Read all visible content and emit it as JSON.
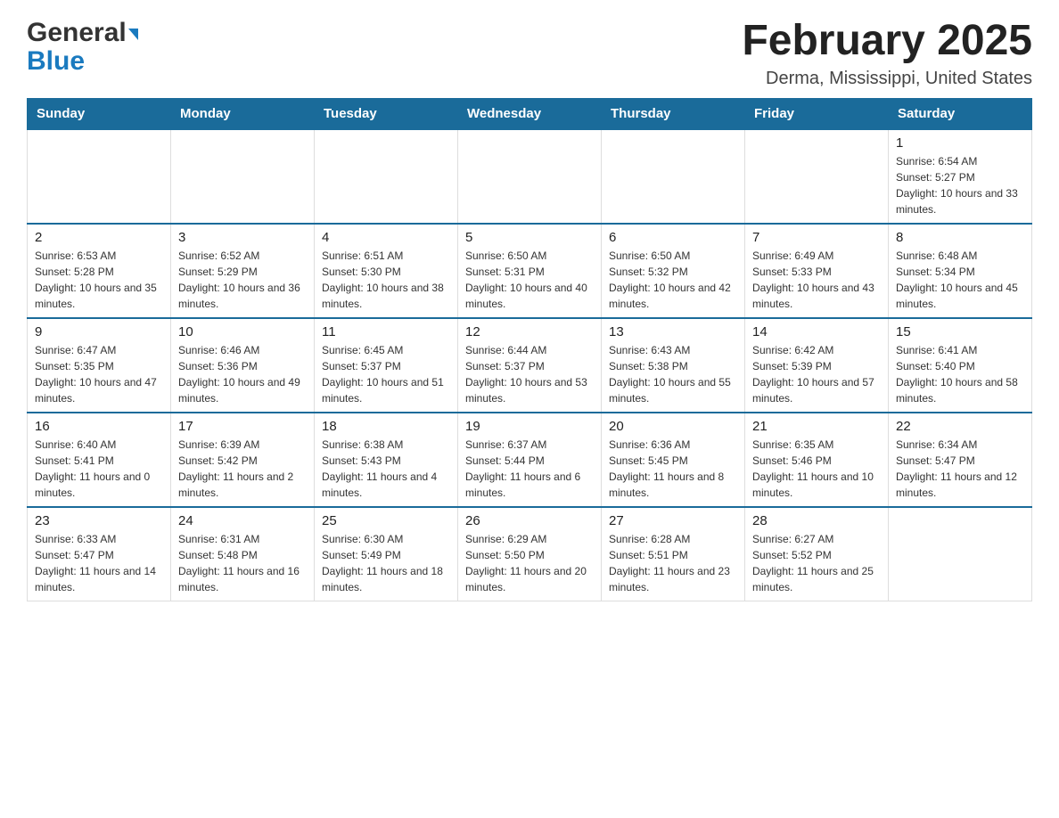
{
  "header": {
    "logo_general": "General",
    "logo_blue": "Blue",
    "month_title": "February 2025",
    "location": "Derma, Mississippi, United States"
  },
  "days_of_week": [
    "Sunday",
    "Monday",
    "Tuesday",
    "Wednesday",
    "Thursday",
    "Friday",
    "Saturday"
  ],
  "weeks": [
    [
      {
        "day": "",
        "info": ""
      },
      {
        "day": "",
        "info": ""
      },
      {
        "day": "",
        "info": ""
      },
      {
        "day": "",
        "info": ""
      },
      {
        "day": "",
        "info": ""
      },
      {
        "day": "",
        "info": ""
      },
      {
        "day": "1",
        "info": "Sunrise: 6:54 AM\nSunset: 5:27 PM\nDaylight: 10 hours and 33 minutes."
      }
    ],
    [
      {
        "day": "2",
        "info": "Sunrise: 6:53 AM\nSunset: 5:28 PM\nDaylight: 10 hours and 35 minutes."
      },
      {
        "day": "3",
        "info": "Sunrise: 6:52 AM\nSunset: 5:29 PM\nDaylight: 10 hours and 36 minutes."
      },
      {
        "day": "4",
        "info": "Sunrise: 6:51 AM\nSunset: 5:30 PM\nDaylight: 10 hours and 38 minutes."
      },
      {
        "day": "5",
        "info": "Sunrise: 6:50 AM\nSunset: 5:31 PM\nDaylight: 10 hours and 40 minutes."
      },
      {
        "day": "6",
        "info": "Sunrise: 6:50 AM\nSunset: 5:32 PM\nDaylight: 10 hours and 42 minutes."
      },
      {
        "day": "7",
        "info": "Sunrise: 6:49 AM\nSunset: 5:33 PM\nDaylight: 10 hours and 43 minutes."
      },
      {
        "day": "8",
        "info": "Sunrise: 6:48 AM\nSunset: 5:34 PM\nDaylight: 10 hours and 45 minutes."
      }
    ],
    [
      {
        "day": "9",
        "info": "Sunrise: 6:47 AM\nSunset: 5:35 PM\nDaylight: 10 hours and 47 minutes."
      },
      {
        "day": "10",
        "info": "Sunrise: 6:46 AM\nSunset: 5:36 PM\nDaylight: 10 hours and 49 minutes."
      },
      {
        "day": "11",
        "info": "Sunrise: 6:45 AM\nSunset: 5:37 PM\nDaylight: 10 hours and 51 minutes."
      },
      {
        "day": "12",
        "info": "Sunrise: 6:44 AM\nSunset: 5:37 PM\nDaylight: 10 hours and 53 minutes."
      },
      {
        "day": "13",
        "info": "Sunrise: 6:43 AM\nSunset: 5:38 PM\nDaylight: 10 hours and 55 minutes."
      },
      {
        "day": "14",
        "info": "Sunrise: 6:42 AM\nSunset: 5:39 PM\nDaylight: 10 hours and 57 minutes."
      },
      {
        "day": "15",
        "info": "Sunrise: 6:41 AM\nSunset: 5:40 PM\nDaylight: 10 hours and 58 minutes."
      }
    ],
    [
      {
        "day": "16",
        "info": "Sunrise: 6:40 AM\nSunset: 5:41 PM\nDaylight: 11 hours and 0 minutes."
      },
      {
        "day": "17",
        "info": "Sunrise: 6:39 AM\nSunset: 5:42 PM\nDaylight: 11 hours and 2 minutes."
      },
      {
        "day": "18",
        "info": "Sunrise: 6:38 AM\nSunset: 5:43 PM\nDaylight: 11 hours and 4 minutes."
      },
      {
        "day": "19",
        "info": "Sunrise: 6:37 AM\nSunset: 5:44 PM\nDaylight: 11 hours and 6 minutes."
      },
      {
        "day": "20",
        "info": "Sunrise: 6:36 AM\nSunset: 5:45 PM\nDaylight: 11 hours and 8 minutes."
      },
      {
        "day": "21",
        "info": "Sunrise: 6:35 AM\nSunset: 5:46 PM\nDaylight: 11 hours and 10 minutes."
      },
      {
        "day": "22",
        "info": "Sunrise: 6:34 AM\nSunset: 5:47 PM\nDaylight: 11 hours and 12 minutes."
      }
    ],
    [
      {
        "day": "23",
        "info": "Sunrise: 6:33 AM\nSunset: 5:47 PM\nDaylight: 11 hours and 14 minutes."
      },
      {
        "day": "24",
        "info": "Sunrise: 6:31 AM\nSunset: 5:48 PM\nDaylight: 11 hours and 16 minutes."
      },
      {
        "day": "25",
        "info": "Sunrise: 6:30 AM\nSunset: 5:49 PM\nDaylight: 11 hours and 18 minutes."
      },
      {
        "day": "26",
        "info": "Sunrise: 6:29 AM\nSunset: 5:50 PM\nDaylight: 11 hours and 20 minutes."
      },
      {
        "day": "27",
        "info": "Sunrise: 6:28 AM\nSunset: 5:51 PM\nDaylight: 11 hours and 23 minutes."
      },
      {
        "day": "28",
        "info": "Sunrise: 6:27 AM\nSunset: 5:52 PM\nDaylight: 11 hours and 25 minutes."
      },
      {
        "day": "",
        "info": ""
      }
    ]
  ]
}
